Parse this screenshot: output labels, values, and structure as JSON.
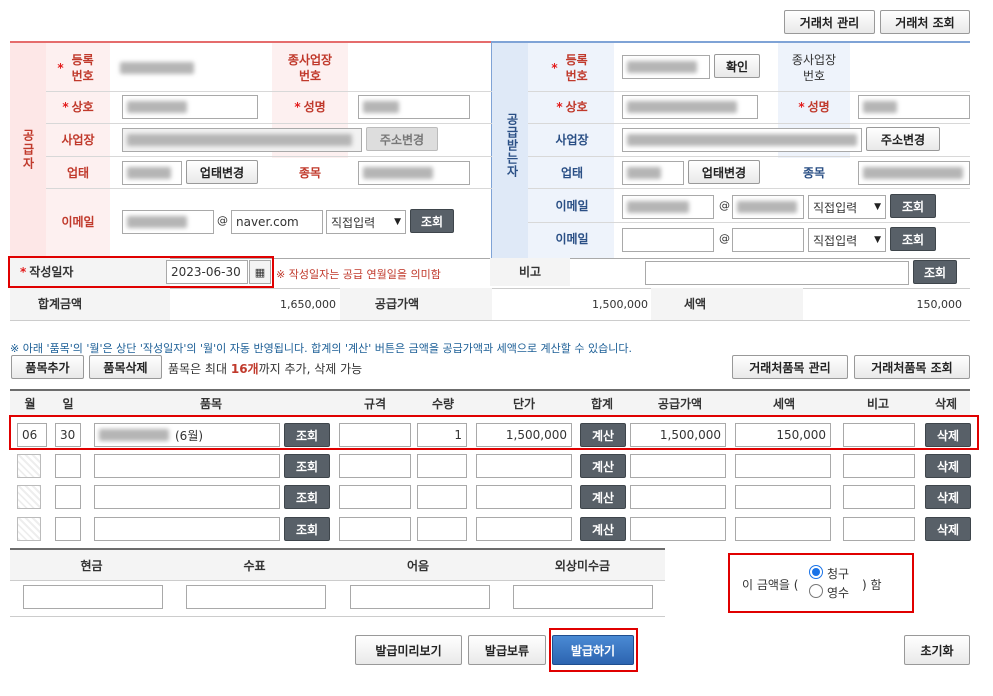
{
  "top_buttons": {
    "partner_manage": "거래처 관리",
    "partner_search": "거래처 조회"
  },
  "supplier": {
    "title": "공급자",
    "reg_no_label": "등록번호",
    "branch_no_label": "종사업장번호",
    "company_label": "상호",
    "ceo_label": "성명",
    "address_label": "사업장",
    "address_change": "주소변경",
    "biz_type_label": "업태",
    "biz_type_change": "업태변경",
    "biz_item_label": "종목",
    "email_label": "이메일",
    "email_at": "@",
    "email_domain": "naver.com",
    "email_select": "직접입력",
    "search_btn": "조회"
  },
  "receiver": {
    "title": "공급받는자",
    "reg_no_label": "등록번호",
    "confirm_btn": "확인",
    "branch_no_label": "종사업장번호",
    "company_label": "상호",
    "ceo_label": "성명",
    "address_label": "사업장",
    "address_change": "주소변경",
    "biz_type_label": "업태",
    "biz_type_change": "업태변경",
    "biz_item_label": "종목",
    "email_label": "이메일",
    "email2_label": "이메일",
    "email_at": "@",
    "email_select": "직접입력",
    "search_btn": "조회"
  },
  "write_date": {
    "label": "작성일자",
    "value": "2023-06-30",
    "notice": "※ 작성일자는 공급 연월일을 의미함",
    "remark_label": "비고",
    "remark_search": "조회"
  },
  "totals": {
    "total_label": "합계금액",
    "total_value": "1,650,000",
    "supply_label": "공급가액",
    "supply_value": "1,500,000",
    "tax_label": "세액",
    "tax_value": "150,000"
  },
  "items_info": {
    "notice": "※ 아래 '품목'의 '월'은 상단 '작성일자'의 '월'이 자동 반영됩니다. 합계의 '계산' 버튼은 금액을 공급가액과 세액으로 계산할 수 있습니다.",
    "add_btn": "품목추가",
    "delete_btn": "품목삭제",
    "limit_pre": "품목은 최대 ",
    "limit_num": "16개",
    "limit_post": "까지 추가, 삭제 가능",
    "manage_btn": "거래처품목 관리",
    "search_btn": "거래처품목 조회"
  },
  "item_table": {
    "headers": [
      "월",
      "일",
      "품목",
      "규격",
      "수량",
      "단가",
      "합계",
      "공급가액",
      "세액",
      "비고",
      "삭제"
    ],
    "search_btn": "조회",
    "calc_btn": "계산",
    "delete_btn": "삭제",
    "row1": {
      "month": "06",
      "day": "30",
      "item_suffix": "(6월)",
      "qty": "1",
      "unit_price": "1,500,000",
      "supply": "1,500,000",
      "tax": "150,000"
    }
  },
  "payment": {
    "headers": [
      "현금",
      "수표",
      "어음",
      "외상미수금"
    ],
    "amount_pre": "이 금액을 (",
    "opt_claim": "청구",
    "opt_receipt": "영수",
    "amount_post": ") 함"
  },
  "bottom": {
    "preview": "발급미리보기",
    "hold": "발급보류",
    "issue": "발급하기",
    "reset": "초기화"
  }
}
